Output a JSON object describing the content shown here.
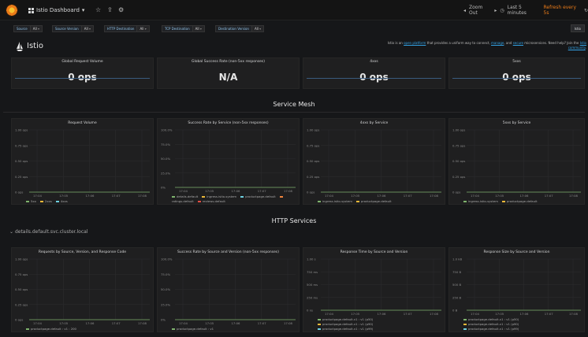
{
  "topnav": {
    "dashboard_title": "Istio Dashboard",
    "zoom_label": "Zoom Out",
    "time_range": "Last 5 minutes",
    "refresh": "Refresh every 5s"
  },
  "variables": [
    {
      "label": "Source",
      "value": "All"
    },
    {
      "label": "Source Version",
      "value": "All"
    },
    {
      "label": "HTTP Destination",
      "value": "All"
    },
    {
      "label": "TCP Destination",
      "value": "All"
    },
    {
      "label": "Destination Version",
      "value": "All"
    }
  ],
  "istio_link": "Istio",
  "header": {
    "title": "Istio",
    "description_pre": "Istio is an ",
    "description_link1": "open platform",
    "description_mid": " that provides a uniform way to connect, ",
    "description_link2": "manage",
    "description_mid2": ", and ",
    "description_link3": "secure",
    "description_post": " microservices. Need help? Join the ",
    "description_link4": "Istio community",
    "description_end": "."
  },
  "stats": [
    {
      "title": "Global Request Volume",
      "value": "0 ops"
    },
    {
      "title": "Global Success Rate (non-5xx responses)",
      "value": "N/A"
    },
    {
      "title": "4xxs",
      "value": "0 ops"
    },
    {
      "title": "5xxs",
      "value": "0 ops"
    }
  ],
  "rows": {
    "service_mesh": "Service Mesh",
    "http_services": "HTTP Services",
    "service_name": "details.default.svc.cluster.local"
  },
  "mesh_panels": [
    {
      "title": "Request Volume",
      "yticks": [
        "1.00 ops",
        "0.75 ops",
        "0.50 ops",
        "0.25 ops",
        "0 ops"
      ],
      "xticks": [
        "17:04",
        "17:05",
        "17:06",
        "17:07",
        "17:08"
      ],
      "legend": [
        "5xx",
        "2xxs",
        "4xxs"
      ],
      "colors": [
        "#7eb26d",
        "#eab839",
        "#6ed0e0"
      ]
    },
    {
      "title": "Success Rate by Service (non-5xx responses)",
      "yticks": [
        "100.0%",
        "75.0%",
        "50.0%",
        "25.0%",
        "0%"
      ],
      "xticks": [
        "17:04",
        "17:05",
        "17:06",
        "17:07",
        "17:08"
      ],
      "legend": [
        "details.default",
        "ingress.istio-system",
        "productpage.default",
        "ratings.default",
        "reviews.default"
      ],
      "colors": [
        "#7eb26d",
        "#eab839",
        "#6ed0e0",
        "#ef843c",
        "#e24d42"
      ]
    },
    {
      "title": "4xxs by Service",
      "yticks": [
        "1.00 ops",
        "0.75 ops",
        "0.50 ops",
        "0.25 ops",
        "0 ops"
      ],
      "xticks": [
        "17:04",
        "17:05",
        "17:06",
        "17:07",
        "17:08"
      ],
      "legend": [
        "ingress.istio-system",
        "productpage.default"
      ],
      "colors": [
        "#7eb26d",
        "#eab839"
      ]
    },
    {
      "title": "5xxs by Service",
      "yticks": [
        "1.00 ops",
        "0.75 ops",
        "0.50 ops",
        "0.25 ops",
        "0 ops"
      ],
      "xticks": [
        "17:04",
        "17:05",
        "17:06",
        "17:07",
        "17:08"
      ],
      "legend": [
        "ingress.istio-system",
        "productpage.default"
      ],
      "colors": [
        "#7eb26d",
        "#eab839"
      ]
    }
  ],
  "http_panels": [
    {
      "title": "Requests by Source, Version, and Response Code",
      "yticks": [
        "1.00 ops",
        "0.75 ops",
        "0.50 ops",
        "0.25 ops",
        "0 ops"
      ],
      "xticks": [
        "17:04",
        "17:05",
        "17:06",
        "17:07",
        "17:08"
      ],
      "legend": [
        "productpage.default : v1 : 200"
      ],
      "colors": [
        "#7eb26d"
      ]
    },
    {
      "title": "Success Rate by Source and Version (non-5xx responses)",
      "yticks": [
        "100.0%",
        "75.0%",
        "50.0%",
        "25.0%",
        "0%"
      ],
      "xticks": [
        "17:04",
        "17:05",
        "17:06",
        "17:07",
        "17:08"
      ],
      "legend": [
        "productpage.default : v1"
      ],
      "colors": [
        "#7eb26d"
      ]
    },
    {
      "title": "Response Time by Source and Version",
      "yticks": [
        "1.00 s",
        "750 ms",
        "500 ms",
        "250 ms",
        "0 ns"
      ],
      "xticks": [
        "17:04",
        "17:05",
        "17:06",
        "17:07",
        "17:08"
      ],
      "legend": [
        "productpage.default.v1 : v1 (p50)",
        "productpage.default.v1 : v1 (p90)",
        "productpage.default.v1 : v1 (p99)"
      ],
      "colors": [
        "#7eb26d",
        "#eab839",
        "#6ed0e0"
      ]
    },
    {
      "title": "Response Size by Source and Version",
      "yticks": [
        "1.0 kB",
        "750 B",
        "500 B",
        "250 B",
        "0 B"
      ],
      "xticks": [
        "17:04",
        "17:05",
        "17:06",
        "17:07",
        "17:08"
      ],
      "legend": [
        "productpage.default.v1 : v1 (p50)",
        "productpage.default.v1 : v1 (p90)",
        "productpage.default.v1 : v1 (p99)"
      ],
      "colors": [
        "#7eb26d",
        "#eab839",
        "#6ed0e0"
      ]
    }
  ],
  "colors": {
    "background": "#161719",
    "panel": "#1f1f20",
    "accent": "#eb7b18",
    "link": "#33a2e5"
  }
}
